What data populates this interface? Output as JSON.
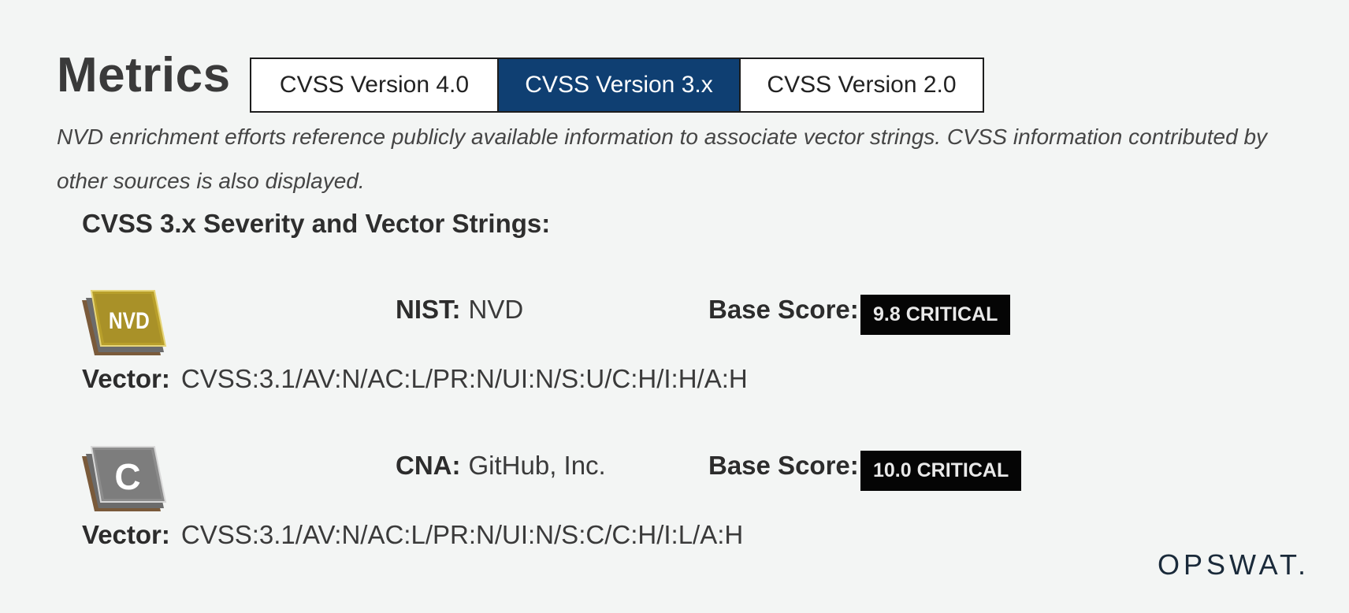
{
  "page_title": "Metrics",
  "tabs": [
    {
      "label": "CVSS Version 4.0",
      "active": false
    },
    {
      "label": "CVSS Version 3.x",
      "active": true
    },
    {
      "label": "CVSS Version 2.0",
      "active": false
    }
  ],
  "intro_text": "NVD enrichment efforts reference publicly available information to associate vector strings. CVSS information contributed by other sources is also displayed.",
  "section_heading": "CVSS 3.x Severity and Vector Strings:",
  "scores": [
    {
      "icon": "nvd-icon",
      "icon_text": "NVD",
      "icon_color": "#b89f2b",
      "source_label": "NIST:",
      "source_value": "NVD",
      "base_score_label": "Base Score:",
      "severity": "9.8 CRITICAL",
      "vector_label": "Vector:",
      "vector_value": "CVSS:3.1/AV:N/AC:L/PR:N/UI:N/S:U/C:H/I:H/A:H"
    },
    {
      "icon": "cna-icon",
      "icon_text": "C",
      "icon_color": "#8c8c8c",
      "source_label": "CNA:",
      "source_value": "GitHub, Inc.",
      "base_score_label": "Base Score:",
      "severity": "10.0 CRITICAL",
      "vector_label": "Vector:",
      "vector_value": "CVSS:3.1/AV:N/AC:L/PR:N/UI:N/S:C/C:H/I:L/A:H"
    }
  ],
  "brand": "OPSWAT."
}
